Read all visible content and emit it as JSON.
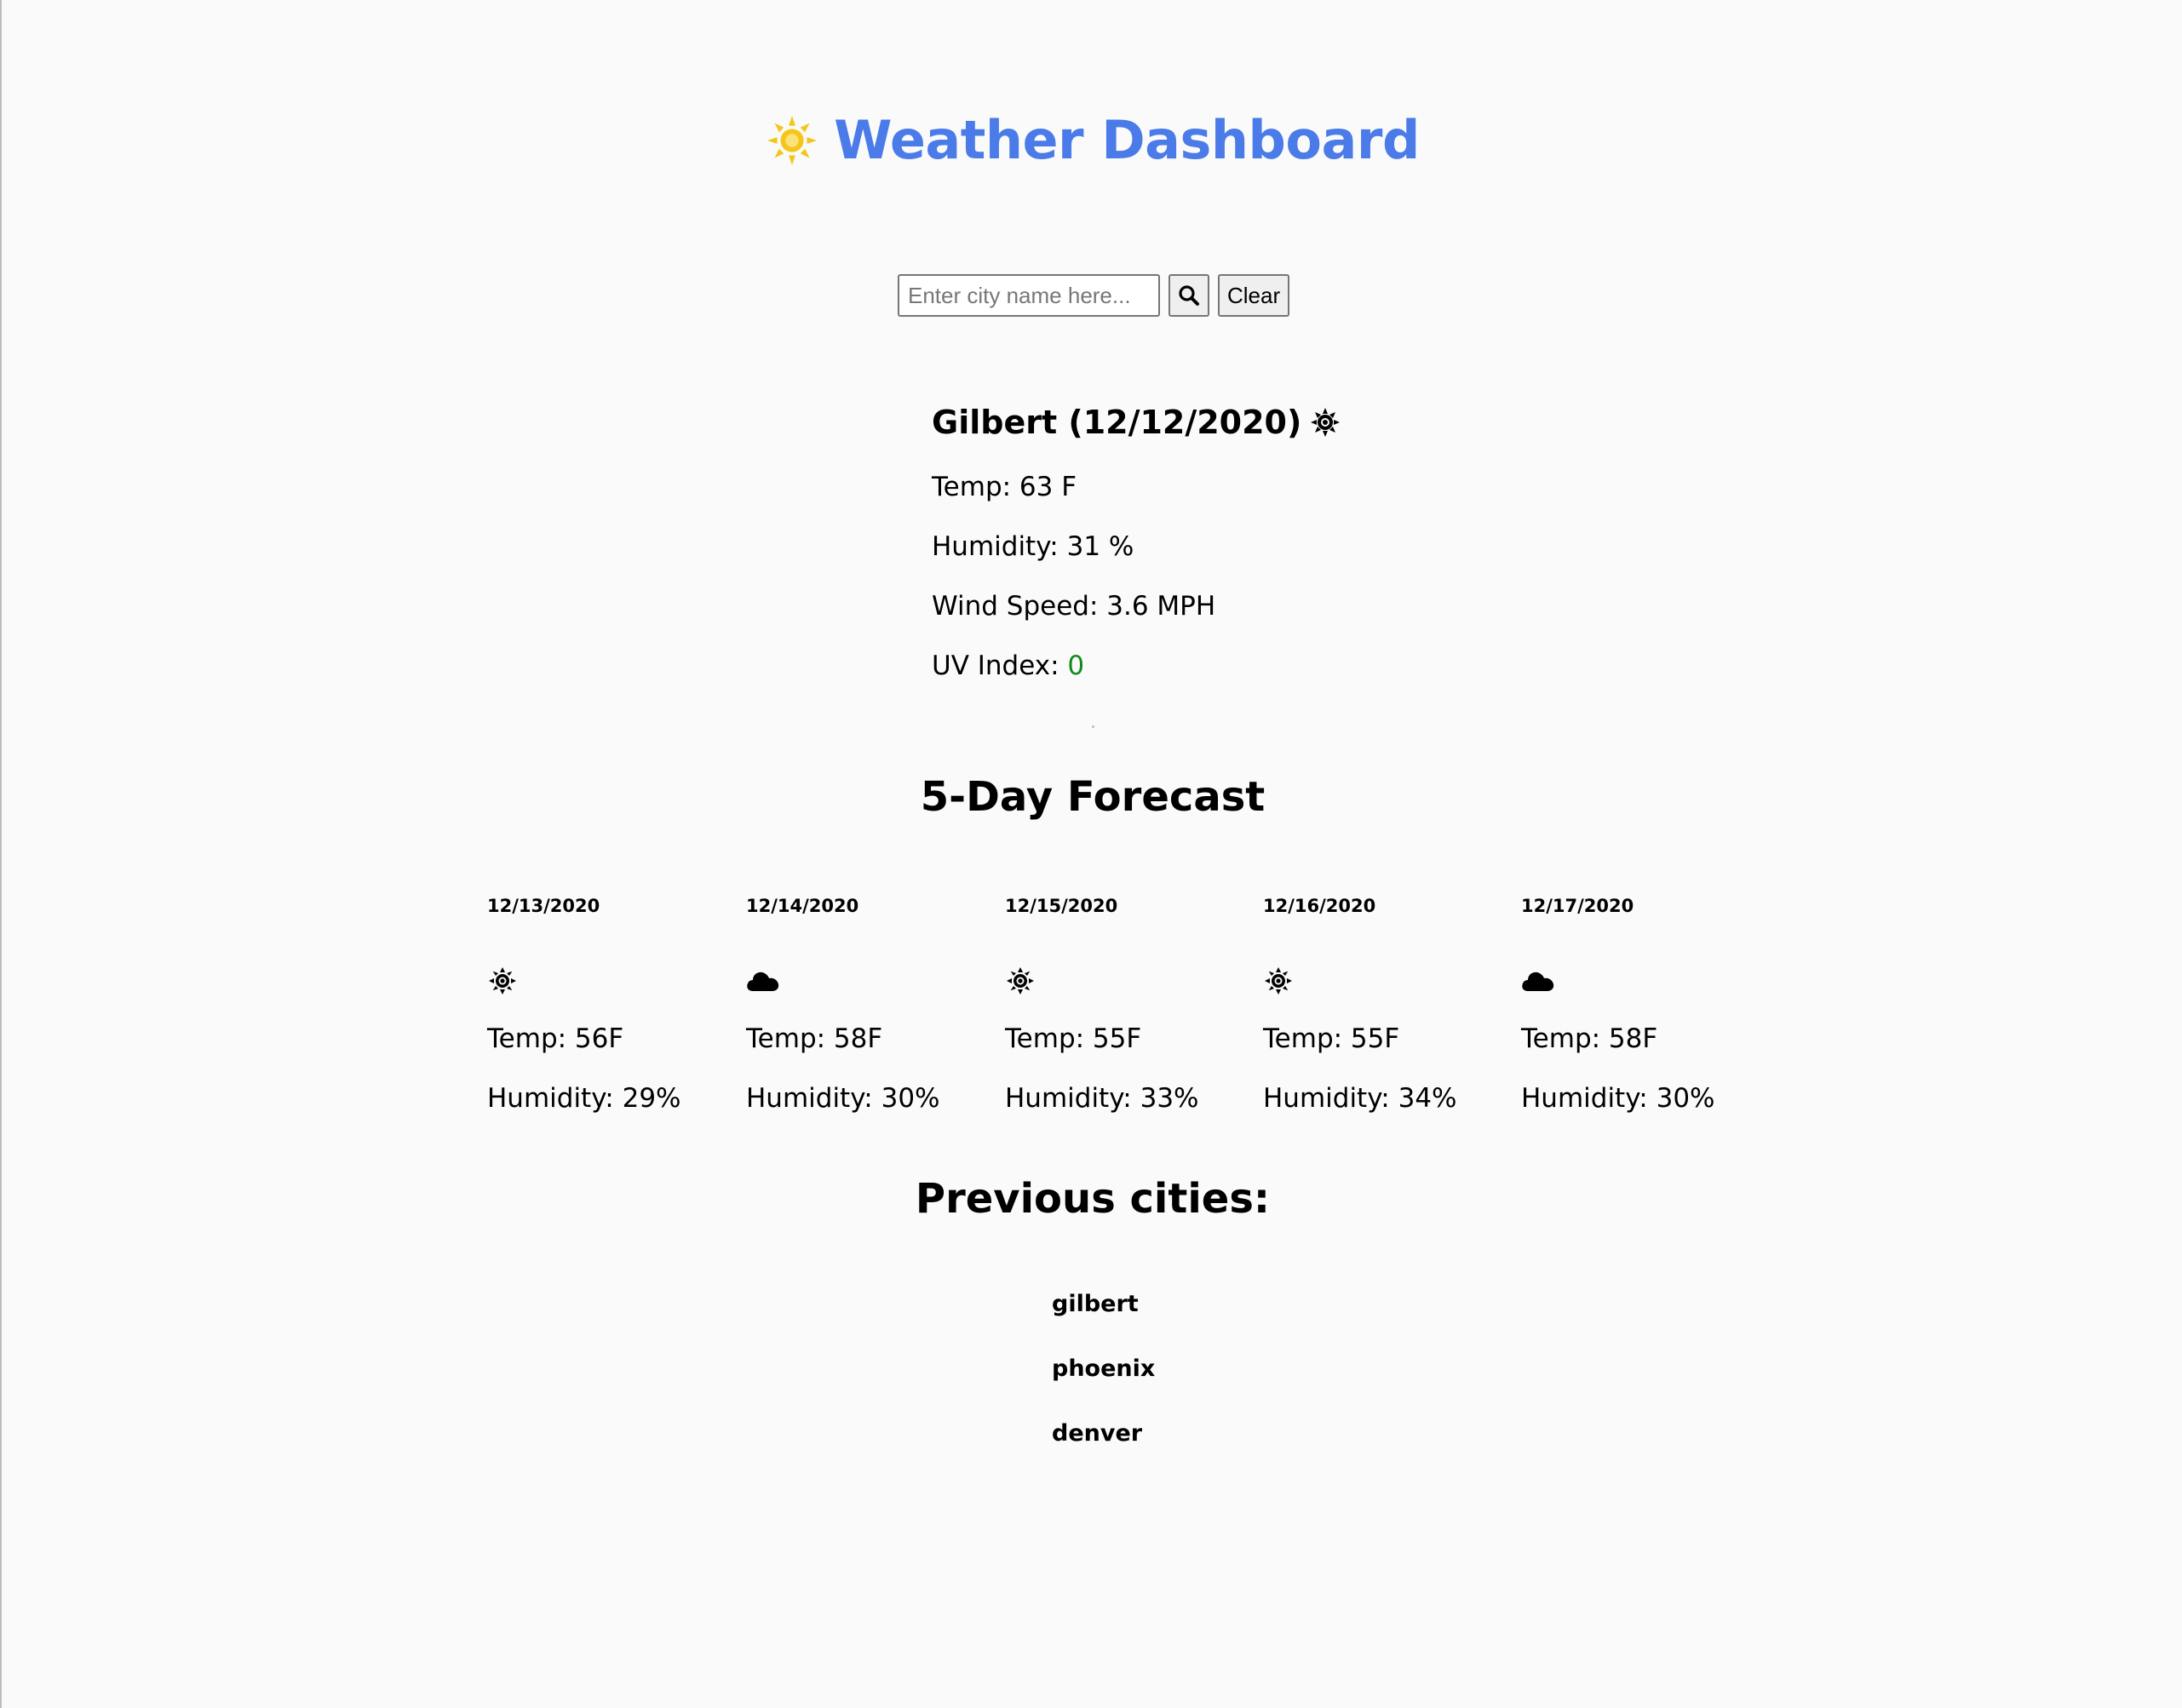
{
  "header": {
    "title": "Weather Dashboard",
    "logo_icon": "sun-icon",
    "title_color": "#4a7be8",
    "logo_color": "#f5c518"
  },
  "search": {
    "placeholder": "Enter city name here...",
    "value": "",
    "search_icon": "search-icon",
    "clear_label": "Clear"
  },
  "current": {
    "title": "Gilbert (12/12/2020)",
    "icon": "sun-icon",
    "temp": "Temp: 63 F",
    "humidity": "Humidity: 31 %",
    "wind": "Wind Speed: 3.6 MPH",
    "uv_label": "UV Index: ",
    "uv_value": "0",
    "uv_color": "#138a1e"
  },
  "forecast": {
    "heading": "5-Day Forecast",
    "days": [
      {
        "date": "12/13/2020",
        "icon": "sun-icon",
        "temp": "Temp: 56F",
        "humidity": "Humidity: 29%"
      },
      {
        "date": "12/14/2020",
        "icon": "cloud-icon",
        "temp": "Temp: 58F",
        "humidity": "Humidity: 30%"
      },
      {
        "date": "12/15/2020",
        "icon": "sun-icon",
        "temp": "Temp: 55F",
        "humidity": "Humidity: 33%"
      },
      {
        "date": "12/16/2020",
        "icon": "sun-icon",
        "temp": "Temp: 55F",
        "humidity": "Humidity: 34%"
      },
      {
        "date": "12/17/2020",
        "icon": "cloud-icon",
        "temp": "Temp: 58F",
        "humidity": "Humidity: 30%"
      }
    ]
  },
  "previous": {
    "heading": "Previous cities:",
    "cities": [
      "gilbert",
      "phoenix",
      "denver"
    ]
  }
}
